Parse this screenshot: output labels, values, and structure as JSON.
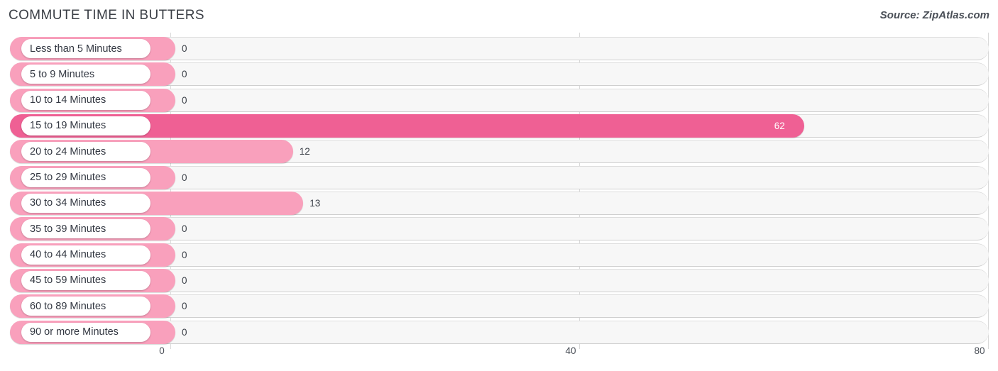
{
  "header": {
    "title": "COMMUTE TIME IN BUTTERS",
    "source": "Source: ZipAtlas.com"
  },
  "colors": {
    "bar_light": "#F9A0BC",
    "bar_accent": "#EF6094",
    "track": "#F7F7F7",
    "gridline": "#D9D9D9",
    "text": "#3A3F47"
  },
  "axis": {
    "ticks": [
      {
        "label": "0",
        "value": 0
      },
      {
        "label": "40",
        "value": 40
      },
      {
        "label": "80",
        "value": 80
      }
    ]
  },
  "chart_data": {
    "type": "bar",
    "orientation": "horizontal",
    "title": "COMMUTE TIME IN BUTTERS",
    "subtitle": "Source: ZipAtlas.com",
    "xlabel": "",
    "ylabel": "",
    "xlim": [
      0,
      80
    ],
    "grid": true,
    "legend": "none",
    "categories": [
      "Less than 5 Minutes",
      "5 to 9 Minutes",
      "10 to 14 Minutes",
      "15 to 19 Minutes",
      "20 to 24 Minutes",
      "25 to 29 Minutes",
      "30 to 34 Minutes",
      "35 to 39 Minutes",
      "40 to 44 Minutes",
      "45 to 59 Minutes",
      "60 to 89 Minutes",
      "90 or more Minutes"
    ],
    "values": [
      0,
      0,
      0,
      62,
      12,
      0,
      13,
      0,
      0,
      0,
      0,
      0
    ],
    "value_labels": [
      "0",
      "0",
      "0",
      "62",
      "12",
      "0",
      "13",
      "0",
      "0",
      "0",
      "0",
      "0"
    ],
    "highlight_index": 3
  },
  "rows": [
    {
      "label": "Less than 5 Minutes",
      "value": 0,
      "value_label": "0",
      "highlight": false
    },
    {
      "label": "5 to 9 Minutes",
      "value": 0,
      "value_label": "0",
      "highlight": false
    },
    {
      "label": "10 to 14 Minutes",
      "value": 0,
      "value_label": "0",
      "highlight": false
    },
    {
      "label": "15 to 19 Minutes",
      "value": 62,
      "value_label": "62",
      "highlight": true
    },
    {
      "label": "20 to 24 Minutes",
      "value": 12,
      "value_label": "12",
      "highlight": false
    },
    {
      "label": "25 to 29 Minutes",
      "value": 0,
      "value_label": "0",
      "highlight": false
    },
    {
      "label": "30 to 34 Minutes",
      "value": 13,
      "value_label": "13",
      "highlight": false
    },
    {
      "label": "35 to 39 Minutes",
      "value": 0,
      "value_label": "0",
      "highlight": false
    },
    {
      "label": "40 to 44 Minutes",
      "value": 0,
      "value_label": "0",
      "highlight": false
    },
    {
      "label": "45 to 59 Minutes",
      "value": 0,
      "value_label": "0",
      "highlight": false
    },
    {
      "label": "60 to 89 Minutes",
      "value": 0,
      "value_label": "0",
      "highlight": false
    },
    {
      "label": "90 or more Minutes",
      "value": 0,
      "value_label": "0",
      "highlight": false
    }
  ]
}
